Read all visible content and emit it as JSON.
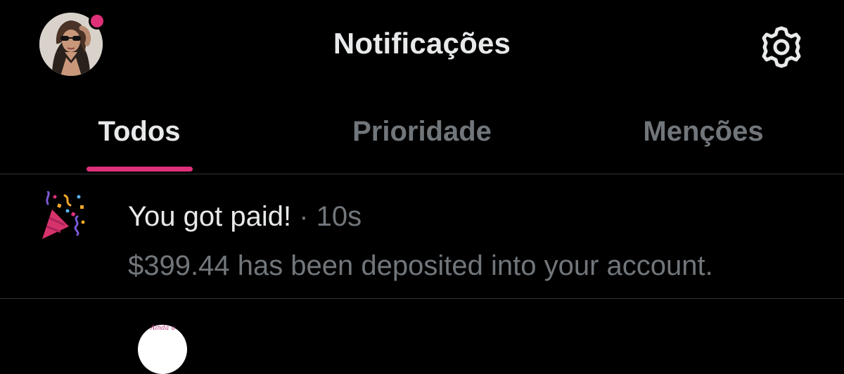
{
  "header": {
    "title": "Notificações",
    "avatar_icon": "profile-avatar",
    "avatar_badge_color": "#e0307a",
    "settings_icon": "gear-icon"
  },
  "tabs": [
    {
      "label": "Todos",
      "active": true
    },
    {
      "label": "Prioridade",
      "active": false
    },
    {
      "label": "Menções",
      "active": false
    }
  ],
  "accent_color": "#e0307a",
  "notifications": [
    {
      "icon": "party-popper-icon",
      "title": "You got paid!",
      "separator": "·",
      "time": "10s",
      "body": "$399.44 has been deposited into your account."
    }
  ],
  "next_item": {
    "avatar_text": "Ainda u"
  }
}
